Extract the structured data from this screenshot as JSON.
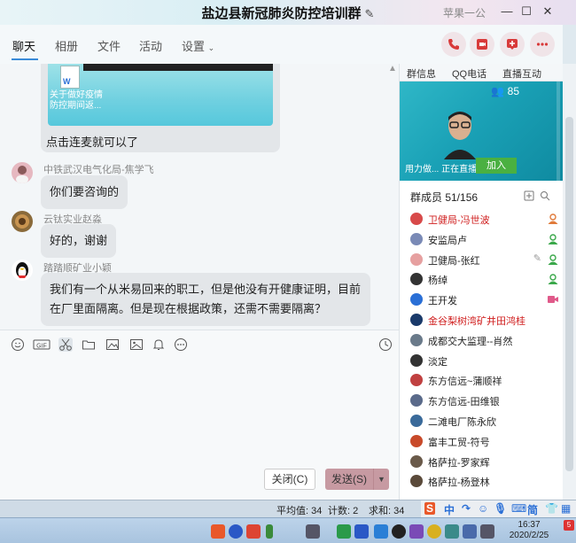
{
  "window": {
    "title": "盐边县新冠肺炎防控培训群",
    "user_name": "苹果一公",
    "controls": [
      "minimize",
      "maximize",
      "close"
    ]
  },
  "tabs": [
    {
      "label": "聊天",
      "active": true
    },
    {
      "label": "相册",
      "active": false
    },
    {
      "label": "文件",
      "active": false
    },
    {
      "label": "活动",
      "active": false
    },
    {
      "label": "设置",
      "active": false
    }
  ],
  "top_actions": [
    "phone-icon",
    "video-icon",
    "share-screen-icon",
    "more-icon"
  ],
  "chat": {
    "card": {
      "file_label": "关于做好疫情防控期间返...",
      "text": "点击连麦就可以了"
    },
    "messages": [
      {
        "sender": "中铁武汉电气化局-焦学飞",
        "text": "你们要咨询的"
      },
      {
        "sender": "云钛实业赵淼",
        "text": "好的，谢谢"
      },
      {
        "sender": "踏踏顺矿业小颖",
        "text_line1": "我们有一个从米易回来的职工，但是他没有开健康证明，目前",
        "text_line2": "在厂里面隔离。但是现在根据政策，还需不需要隔离？"
      }
    ]
  },
  "toolbar_icons": [
    "emoji-icon",
    "gif-icon",
    "scissors-icon",
    "folder-icon",
    "image-icon",
    "photo-icon",
    "bell-icon",
    "more-circle-icon",
    "history-clock-icon"
  ],
  "buttons": {
    "close": "关闭(C)",
    "send": "发送(S)"
  },
  "right_panel": {
    "tabs": [
      "群信息",
      "QQ电话",
      "直播互动"
    ],
    "viewer_count": "85",
    "live_text": "用力做... 正在直播",
    "join_label": "加入",
    "members_header": "群成员 51/156",
    "members": [
      {
        "name": "卫健局-冯世波",
        "red": true,
        "status": "owner"
      },
      {
        "name": "安监局卢",
        "red": false,
        "status": "admin"
      },
      {
        "name": "卫健局-张红",
        "red": false,
        "status": "admin"
      },
      {
        "name": "杨绰",
        "red": false,
        "status": "admin"
      },
      {
        "name": "王开发",
        "red": false,
        "status": "video"
      },
      {
        "name": "金谷梨树湾矿井田鸿桂",
        "red": true,
        "status": ""
      },
      {
        "name": "成都交大监理--肖然",
        "red": false,
        "status": ""
      },
      {
        "name": "淡定",
        "red": false,
        "status": ""
      },
      {
        "name": "东方信远~蒲顺祥",
        "red": false,
        "status": ""
      },
      {
        "name": "东方信远-田维银",
        "red": false,
        "status": ""
      },
      {
        "name": "二滩电厂陈永欣",
        "red": false,
        "status": ""
      },
      {
        "name": "富丰工贸-符号",
        "red": false,
        "status": ""
      },
      {
        "name": "格萨拉-罗家辉",
        "red": false,
        "status": ""
      },
      {
        "name": "格萨拉-杨登林",
        "red": false,
        "status": ""
      }
    ]
  },
  "statusbar": {
    "average": "平均值: 34",
    "count": "计数: 2",
    "sum": "求和: 34"
  },
  "ime": [
    "中",
    "简"
  ],
  "taskbar": {
    "time": "16:37",
    "date": "2020/2/25",
    "notification_count": "5"
  }
}
